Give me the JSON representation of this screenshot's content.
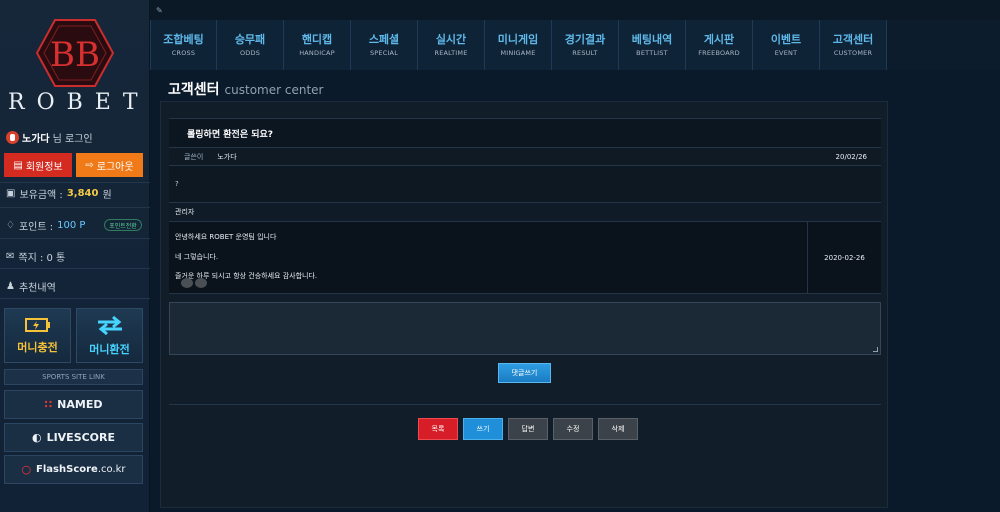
{
  "brand": {
    "logo_text": "BB",
    "name": "ROBET"
  },
  "user": {
    "name": "노가다",
    "suffix": "님 로그인"
  },
  "buttons": {
    "member_info": "회원정보",
    "logout": "로그아웃"
  },
  "balance": {
    "label": "보유금액 : ",
    "value": "3,840",
    "unit": " 원"
  },
  "points": {
    "label": "포인트 : ",
    "value": "100 P",
    "convert": "포인트전환"
  },
  "messages": {
    "label": "쪽지 : 0 통"
  },
  "referral": {
    "label": "추천내역"
  },
  "money": {
    "charge": "머니충전",
    "exchange": "머니환전"
  },
  "sports_link": {
    "heading": "SPORTS SITE LINK",
    "named": "NAMED",
    "livescore": "LIVESCORE",
    "flashscore": "FlashScore",
    "flashscore_suffix": ".co.kr"
  },
  "nav": [
    {
      "ko": "조합베팅",
      "en": "CROSS"
    },
    {
      "ko": "승무패",
      "en": "ODDS"
    },
    {
      "ko": "핸디캡",
      "en": "HANDICAP"
    },
    {
      "ko": "스페셜",
      "en": "SPECIAL"
    },
    {
      "ko": "실시간",
      "en": "REALTIME"
    },
    {
      "ko": "미니게임",
      "en": "MINIGAME"
    },
    {
      "ko": "경기결과",
      "en": "RESULT"
    },
    {
      "ko": "베팅내역",
      "en": "BETTLIST"
    },
    {
      "ko": "게시판",
      "en": "FREEBOARD"
    },
    {
      "ko": "이벤트",
      "en": "EVENT"
    },
    {
      "ko": "고객센터",
      "en": "CUSTOMER"
    }
  ],
  "page": {
    "title_ko": "고객센터",
    "title_en": "customer center"
  },
  "post": {
    "title": "롤링하면 환전은 되요?",
    "author_label": "글쓴이",
    "author": "노가다",
    "date": "20/02/26",
    "body": "?"
  },
  "reply": {
    "author": "관리자",
    "line1": "안녕하세요 ROBET 운영팀 입니다",
    "line2": "네 그렇습니다.",
    "line3": "즐거운 하루 되시고 항상 건승하세요 감사합니다.",
    "date": "2020-02-26"
  },
  "comment": {
    "submit": "댓글쓰기"
  },
  "actions": {
    "list": "목록",
    "write": "쓰기",
    "answer": "답변",
    "edit": "수정",
    "delete": "삭제"
  },
  "colors": {
    "accent": "#5fb8ea",
    "red": "#d42b20",
    "orange": "#f07a18",
    "gold": "#f6c945"
  }
}
